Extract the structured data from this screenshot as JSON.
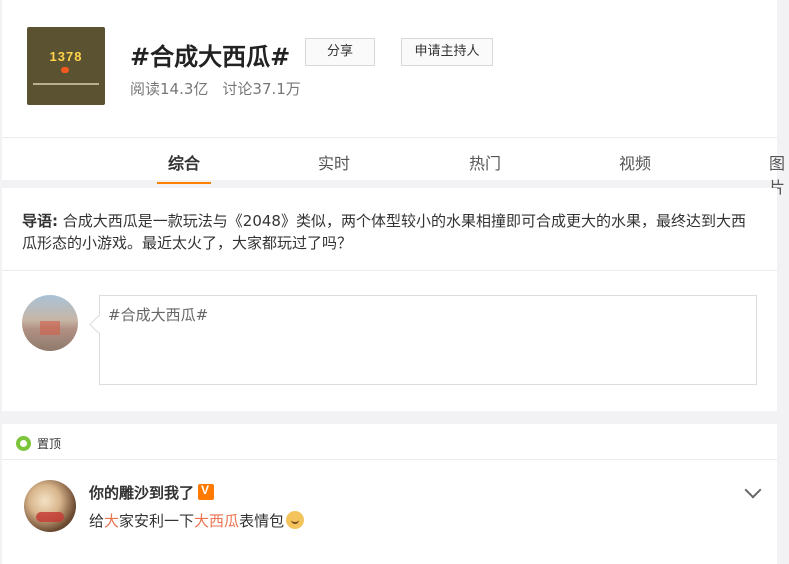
{
  "topic": {
    "cover_number": "1378",
    "title": "#合成大西瓜#",
    "read_count": "阅读14.3亿",
    "discuss_count": "讨论37.1万",
    "share_label": "分享",
    "apply_host_label": "申请主持人"
  },
  "tabs": [
    {
      "label": "综合"
    },
    {
      "label": "实时"
    },
    {
      "label": "热门"
    },
    {
      "label": "视频"
    },
    {
      "label": "图片"
    }
  ],
  "lead": {
    "label": "导语:",
    "text": "合成大西瓜是一款玩法与《2048》类似，两个体型较小的水果相撞即可合成更大的水果，最终达到大西瓜形态的小游戏。最近太火了，大家都玩过了吗？"
  },
  "composer": {
    "text": "#合成大西瓜#"
  },
  "post": {
    "pinned_label": "置顶",
    "author": "你的雕沙到我了",
    "text_prefix": "给",
    "text_hl1": "大",
    "text_mid": "家安利一下",
    "text_hl2": "大西瓜",
    "text_suffix": "表情包"
  },
  "colors": {
    "accent": "#ff8200",
    "highlight": "#eb7350",
    "vip": "#ff7a00",
    "pin": "#7cc53a"
  },
  "icons": [
    "chevron-down-icon",
    "pin-icon",
    "vip-badge-icon",
    "emoji-icon"
  ]
}
